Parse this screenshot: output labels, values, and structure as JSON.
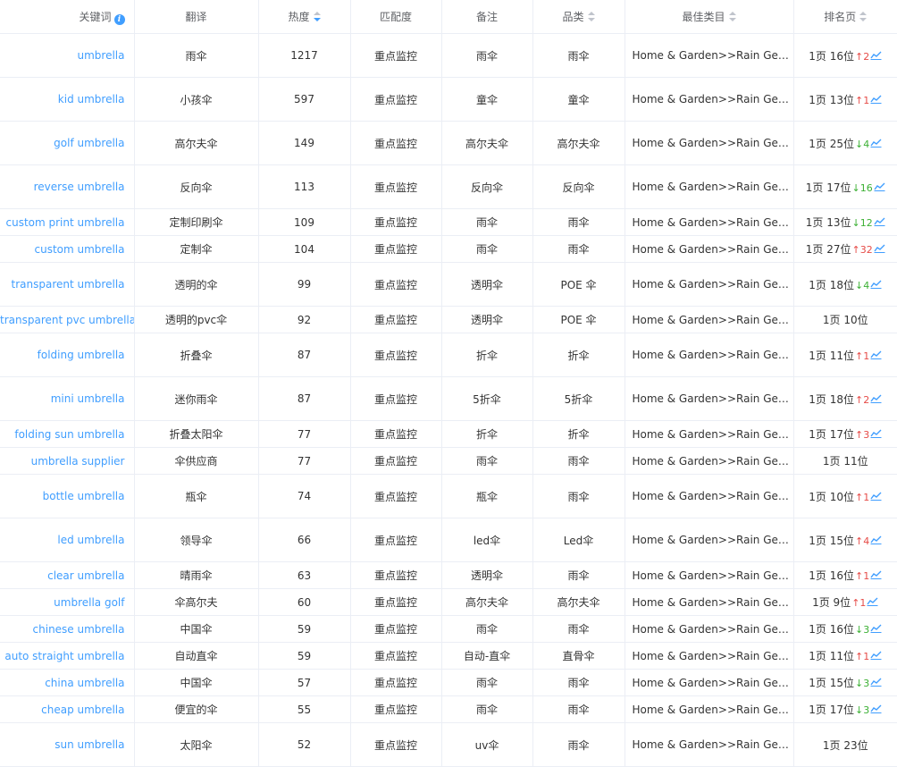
{
  "columns": {
    "keyword": "关键词",
    "translation": "翻译",
    "heat": "热度",
    "match": "匹配度",
    "note": "备注",
    "category": "品类",
    "best_category": "最佳类目",
    "rank": "排名页"
  },
  "rows": [
    {
      "keyword": "umbrella",
      "translation": "雨伞",
      "heat": "1217",
      "match": "重点监控",
      "note": "雨伞",
      "category": "雨伞",
      "best": "Home & Garden>>Rain Gear>…",
      "rank": "1页 16位",
      "dir": "new",
      "arrow": "↑",
      "change": "2",
      "chart": true,
      "size": "tall"
    },
    {
      "keyword": "kid umbrella",
      "translation": "小孩伞",
      "heat": "597",
      "match": "重点监控",
      "note": "童伞",
      "category": "童伞",
      "best": "Home & Garden>>Rain Gear>…",
      "rank": "1页 13位",
      "dir": "up",
      "arrow": "↑",
      "change": "1",
      "chart": true,
      "size": "tall"
    },
    {
      "keyword": "golf umbrella",
      "translation": "高尔夫伞",
      "heat": "149",
      "match": "重点监控",
      "note": "高尔夫伞",
      "category": "高尔夫伞",
      "best": "Home & Garden>>Rain Gear>…",
      "rank": "1页 25位",
      "dir": "down",
      "arrow": "↓",
      "change": "4",
      "chart": true,
      "size": "tall"
    },
    {
      "keyword": "reverse umbrella",
      "translation": "反向伞",
      "heat": "113",
      "match": "重点监控",
      "note": "反向伞",
      "category": "反向伞",
      "best": "Home & Garden>>Rain Gear>…",
      "rank": "1页 17位",
      "dir": "down",
      "arrow": "↓",
      "change": "16",
      "chart": true,
      "size": "tall"
    },
    {
      "keyword": "custom print umbrella",
      "translation": "定制印刷伞",
      "heat": "109",
      "match": "重点监控",
      "note": "雨伞",
      "category": "雨伞",
      "best": "Home & Garden>>Rain Gear>…",
      "rank": "1页 13位",
      "dir": "down",
      "arrow": "↓",
      "change": "12",
      "chart": true,
      "size": "short"
    },
    {
      "keyword": "custom umbrella",
      "translation": "定制伞",
      "heat": "104",
      "match": "重点监控",
      "note": "雨伞",
      "category": "雨伞",
      "best": "Home & Garden>>Rain Gear>…",
      "rank": "1页 27位",
      "dir": "new",
      "arrow": "↑",
      "change": "32",
      "chart": true,
      "size": "short"
    },
    {
      "keyword": "transparent umbrella",
      "translation": "透明的伞",
      "heat": "99",
      "match": "重点监控",
      "note": "透明伞",
      "category": "POE 伞",
      "best": "Home & Garden>>Rain Gear>…",
      "rank": "1页 18位",
      "dir": "down",
      "arrow": "↓",
      "change": "4",
      "chart": true,
      "size": "tall"
    },
    {
      "keyword": "transparent pvc umbrella",
      "translation": "透明的pvc伞",
      "heat": "92",
      "match": "重点监控",
      "note": "透明伞",
      "category": "POE 伞",
      "best": "Home & Garden>>Rain Gear>…",
      "rank": "1页 10位",
      "dir": "",
      "arrow": "",
      "change": "",
      "chart": false,
      "size": "short"
    },
    {
      "keyword": "folding umbrella",
      "translation": "折叠伞",
      "heat": "87",
      "match": "重点监控",
      "note": "折伞",
      "category": "折伞",
      "best": "Home & Garden>>Rain Gear>…",
      "rank": "1页 11位",
      "dir": "up",
      "arrow": "↑",
      "change": "1",
      "chart": true,
      "size": "tall"
    },
    {
      "keyword": "mini umbrella",
      "translation": "迷你雨伞",
      "heat": "87",
      "match": "重点监控",
      "note": "5折伞",
      "category": "5折伞",
      "best": "Home & Garden>>Rain Gear>…",
      "rank": "1页 18位",
      "dir": "new",
      "arrow": "↑",
      "change": "2",
      "chart": true,
      "size": "tall"
    },
    {
      "keyword": "folding sun umbrella",
      "translation": "折叠太阳伞",
      "heat": "77",
      "match": "重点监控",
      "note": "折伞",
      "category": "折伞",
      "best": "Home & Garden>>Rain Gear>…",
      "rank": "1页 17位",
      "dir": "new",
      "arrow": "↑",
      "change": "3",
      "chart": true,
      "size": "short"
    },
    {
      "keyword": "umbrella supplier",
      "translation": "伞供应商",
      "heat": "77",
      "match": "重点监控",
      "note": "雨伞",
      "category": "雨伞",
      "best": "Home & Garden>>Rain Gear>…",
      "rank": "1页 11位",
      "dir": "",
      "arrow": "",
      "change": "",
      "chart": false,
      "size": "short"
    },
    {
      "keyword": "bottle umbrella",
      "translation": "瓶伞",
      "heat": "74",
      "match": "重点监控",
      "note": "瓶伞",
      "category": "雨伞",
      "best": "Home & Garden>>Rain Gear>…",
      "rank": "1页 10位",
      "dir": "up",
      "arrow": "↑",
      "change": "1",
      "chart": true,
      "size": "tall"
    },
    {
      "keyword": "led umbrella",
      "translation": "领导伞",
      "heat": "66",
      "match": "重点监控",
      "note": "led伞",
      "category": "Led伞",
      "best": "Home & Garden>>Rain Gear>…",
      "rank": "1页 15位",
      "dir": "up",
      "arrow": "↑",
      "change": "4",
      "chart": true,
      "size": "tall"
    },
    {
      "keyword": "clear umbrella",
      "translation": "晴雨伞",
      "heat": "63",
      "match": "重点监控",
      "note": "透明伞",
      "category": "雨伞",
      "best": "Home & Garden>>Rain Gear>…",
      "rank": "1页 16位",
      "dir": "up",
      "arrow": "↑",
      "change": "1",
      "chart": true,
      "size": "short"
    },
    {
      "keyword": "umbrella golf",
      "translation": "伞高尔夫",
      "heat": "60",
      "match": "重点监控",
      "note": "高尔夫伞",
      "category": "高尔夫伞",
      "best": "Home & Garden>>Rain Gear>…",
      "rank": "1页 9位",
      "dir": "up",
      "arrow": "↑",
      "change": "1",
      "chart": true,
      "size": "short"
    },
    {
      "keyword": "chinese umbrella",
      "translation": "中国伞",
      "heat": "59",
      "match": "重点监控",
      "note": "雨伞",
      "category": "雨伞",
      "best": "Home & Garden>>Rain Gear>…",
      "rank": "1页 16位",
      "dir": "down",
      "arrow": "↓",
      "change": "3",
      "chart": true,
      "size": "short"
    },
    {
      "keyword": "auto straight umbrella",
      "translation": "自动直伞",
      "heat": "59",
      "match": "重点监控",
      "note": "自动-直伞",
      "category": "直骨伞",
      "best": "Home & Garden>>Rain Gear>…",
      "rank": "1页 11位",
      "dir": "up",
      "arrow": "↑",
      "change": "1",
      "chart": true,
      "size": "short"
    },
    {
      "keyword": "china umbrella",
      "translation": "中国伞",
      "heat": "57",
      "match": "重点监控",
      "note": "雨伞",
      "category": "雨伞",
      "best": "Home & Garden>>Rain Gear>…",
      "rank": "1页 15位",
      "dir": "down",
      "arrow": "↓",
      "change": "3",
      "chart": true,
      "size": "short"
    },
    {
      "keyword": "cheap umbrella",
      "translation": "便宜的伞",
      "heat": "55",
      "match": "重点监控",
      "note": "雨伞",
      "category": "雨伞",
      "best": "Home & Garden>>Rain Gear>…",
      "rank": "1页 17位",
      "dir": "down",
      "arrow": "↓",
      "change": "3",
      "chart": true,
      "size": "short"
    },
    {
      "keyword": "sun umbrella",
      "translation": "太阳伞",
      "heat": "52",
      "match": "重点监控",
      "note": "uv伞",
      "category": "雨伞",
      "best": "Home & Garden>>Rain Gear>…",
      "rank": "1页 23位",
      "dir": "",
      "arrow": "",
      "change": "",
      "chart": false,
      "size": "tall"
    }
  ],
  "colors": {
    "link": "#409eff",
    "up": "#e64b47",
    "down": "#3cb034",
    "border": "#ebeef5"
  },
  "icons": {
    "info": "info-circle-icon",
    "sort": "sort-caret-icon",
    "trend": "line-chart-icon"
  }
}
